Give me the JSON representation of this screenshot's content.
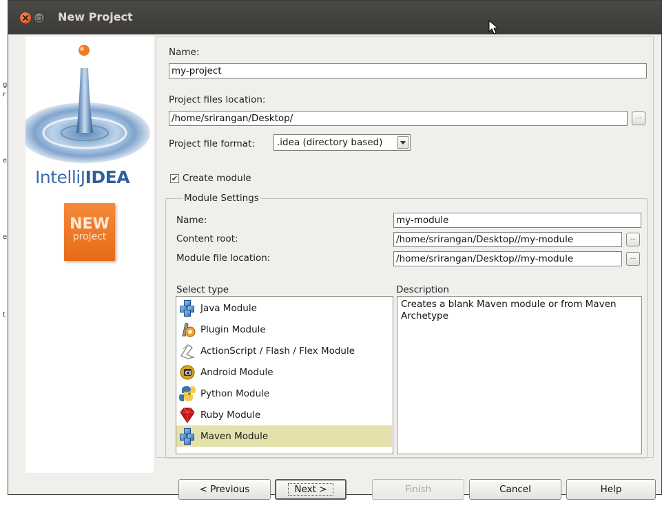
{
  "window": {
    "title": "New Project"
  },
  "project": {
    "name_label": "Name:",
    "name_value": "my-project",
    "location_label": "Project files location:",
    "location_value": "/home/srirangan/Desktop/",
    "browse_label": "...",
    "format_label": "Project file format:",
    "format_value": ".idea (directory based)",
    "create_module_label": "Create module",
    "create_module_checked": true
  },
  "branding": {
    "logo_a": "IntelliJ",
    "logo_b": "IDEA",
    "badge_top": "NEW",
    "badge_bottom": "project"
  },
  "module_settings": {
    "group_title": "Module Settings",
    "name_label": "Name:",
    "name_value": "my-module",
    "content_root_label": "Content root:",
    "content_root_value": "/home/srirangan/Desktop//my-module",
    "file_location_label": "Module file location:",
    "file_location_value": "/home/srirangan/Desktop//my-module",
    "select_type_label": "Select type",
    "description_label": "Description",
    "types": [
      {
        "label": "Java Module",
        "icon": "java-module-icon"
      },
      {
        "label": "Plugin Module",
        "icon": "plugin-module-icon"
      },
      {
        "label": "ActionScript / Flash / Flex Module",
        "icon": "flex-module-icon"
      },
      {
        "label": "Android Module",
        "icon": "android-module-icon"
      },
      {
        "label": "Python Module",
        "icon": "python-module-icon"
      },
      {
        "label": "Ruby Module",
        "icon": "ruby-module-icon"
      },
      {
        "label": "Maven Module",
        "icon": "maven-module-icon"
      }
    ],
    "selected_type": "Maven Module",
    "description": "Creates a blank Maven module or from Maven Archetype"
  },
  "buttons": {
    "previous": "< Previous",
    "next": "Next >",
    "finish": "Finish",
    "cancel": "Cancel",
    "help": "Help"
  },
  "colors": {
    "titlebar": "#3c3b37",
    "dialog_bg": "#f1efec",
    "selection": "#e4e1ad",
    "close_button": "#df4a15",
    "badge": "#e66b17"
  }
}
